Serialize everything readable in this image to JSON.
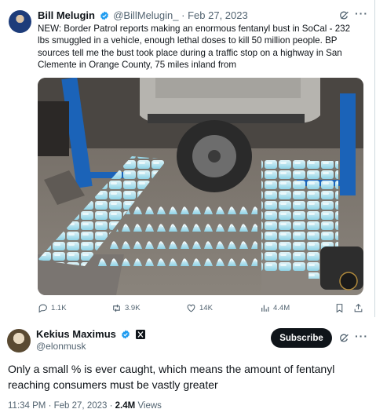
{
  "quoted_tweet": {
    "author_name": "Bill Melugin",
    "author_handle": "@BillMelugin_",
    "separator": "·",
    "date": "Feb 27, 2023",
    "text": "NEW: Border Patrol reports making an enormous fentanyl bust in SoCal - 232 lbs smuggled in a vehicle, enough lethal doses to kill 50 million people. BP sources tell me the bust took place during a traffic stop on a highway in San Clemente in Orange County, 75 miles inland from",
    "metrics": {
      "replies": "1.1K",
      "reposts": "3.9K",
      "likes": "14K",
      "views": "4.4M"
    }
  },
  "tweet": {
    "author_name": "Kekius Maximus",
    "author_handle": "@elonmusk",
    "subscribe_label": "Subscribe",
    "text": "Only a small % is ever caught, which means the amount of fentanyl reaching consumers must be vastly greater",
    "time": "11:34 PM",
    "separator": "·",
    "date": "Feb 27, 2023",
    "separator2": "·",
    "views_count": "2.4M",
    "views_label": "Views"
  },
  "colors": {
    "verified": "#1d9bf0",
    "muted_text": "#536471",
    "subscribe_bg": "#0f1419"
  }
}
